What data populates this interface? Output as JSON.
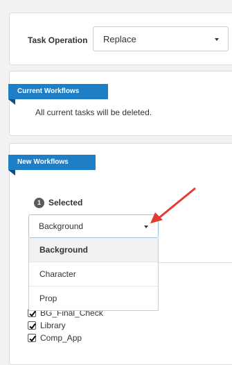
{
  "task_operation": {
    "label": "Task Operation",
    "selected": "Replace"
  },
  "current_workflows": {
    "title": "Current Workflows",
    "message": "All current tasks will be deleted."
  },
  "new_workflows": {
    "title": "New Workflows",
    "step_number": "1",
    "step_label": "Selected",
    "workflow_select": {
      "selected": "Background",
      "options": [
        "Background",
        "Character",
        "Prop"
      ]
    },
    "checklist": [
      {
        "label": "BG_Final_Check",
        "checked": true
      },
      {
        "label": "Library",
        "checked": true
      },
      {
        "label": "Comp_App",
        "checked": true
      }
    ]
  },
  "colors": {
    "ribbon": "#1e7fc6",
    "arrow": "#e53935"
  },
  "icons": [
    "chevron-down-icon",
    "checkmark-icon",
    "step-number-badge",
    "annotation-arrow"
  ]
}
